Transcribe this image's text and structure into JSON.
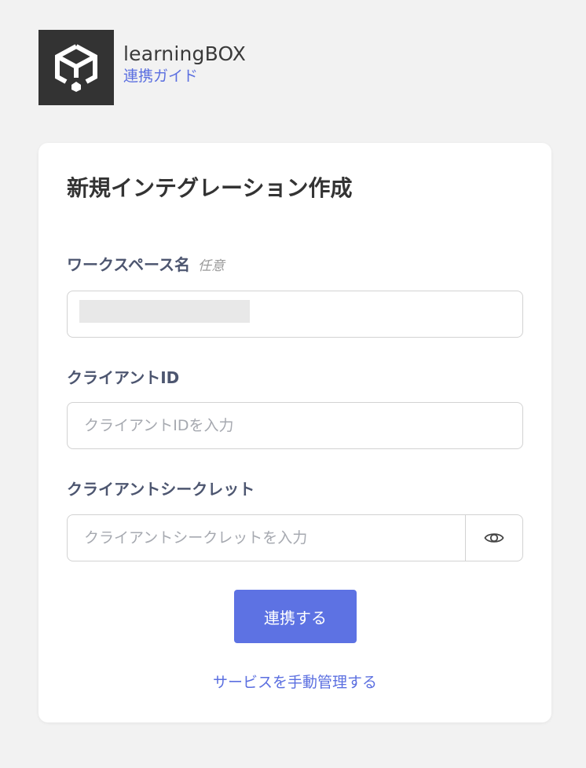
{
  "header": {
    "app_name": "learningBOX",
    "guide_link": "連携ガイド"
  },
  "form": {
    "title": "新規インテグレーション作成",
    "workspace": {
      "label": "ワークスペース名",
      "optional_tag": "任意"
    },
    "client_id": {
      "label": "クライアントID",
      "placeholder": "クライアントIDを入力"
    },
    "client_secret": {
      "label": "クライアントシークレット",
      "placeholder": "クライアントシークレットを入力",
      "visibility_icon": "eye-icon"
    },
    "submit_label": "連携する",
    "manual_link": "サービスを手動管理する"
  },
  "colors": {
    "accent": "#5d72e3",
    "link": "#5b6fe0",
    "logo_bg": "#333333",
    "page_bg": "#f2f2f2",
    "label": "#4d5670"
  }
}
